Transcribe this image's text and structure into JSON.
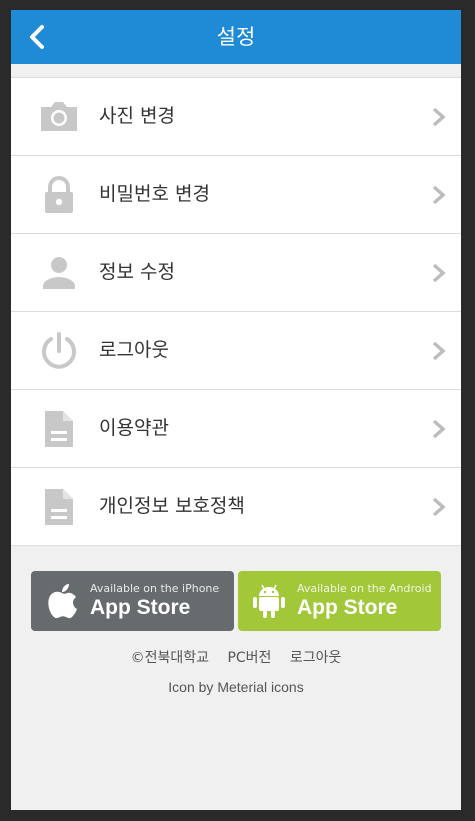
{
  "header": {
    "title": "설정",
    "back_icon": "chevron-left-icon",
    "color": "#1f8bd6"
  },
  "menu": {
    "items": [
      {
        "label": "사진 변경",
        "icon": "camera-icon"
      },
      {
        "label": "비밀번호 변경",
        "icon": "lock-icon"
      },
      {
        "label": "정보 수정",
        "icon": "person-icon"
      },
      {
        "label": "로그아웃",
        "icon": "power-icon"
      },
      {
        "label": "이용약관",
        "icon": "document-icon"
      },
      {
        "label": "개인정보 보호정책",
        "icon": "document-icon"
      }
    ],
    "chevron_icon": "chevron-right-icon"
  },
  "stores": {
    "ios": {
      "small": "Available on the iPhone",
      "big": "App Store",
      "icon": "apple-icon",
      "color": "#666b6e"
    },
    "android": {
      "small": "Available on the Android",
      "big": "App Store",
      "icon": "android-icon",
      "color": "#a2c83a"
    }
  },
  "footer": {
    "links": [
      "©전북대학교",
      "PC버전",
      "로그아웃"
    ],
    "credit": "Icon by Meterial icons"
  }
}
